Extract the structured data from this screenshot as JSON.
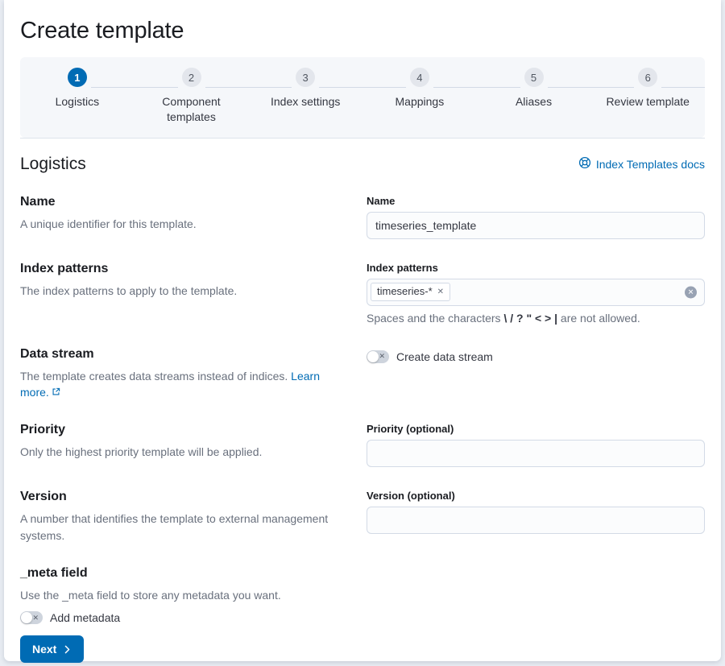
{
  "page": {
    "title": "Create template"
  },
  "stepper": {
    "steps": [
      {
        "number": "1",
        "label": "Logistics",
        "status": "active"
      },
      {
        "number": "2",
        "label": "Component templates",
        "status": "incomplete"
      },
      {
        "number": "3",
        "label": "Index settings",
        "status": "incomplete"
      },
      {
        "number": "4",
        "label": "Mappings",
        "status": "incomplete"
      },
      {
        "number": "5",
        "label": "Aliases",
        "status": "incomplete"
      },
      {
        "number": "6",
        "label": "Review template",
        "status": "incomplete"
      }
    ]
  },
  "section": {
    "title": "Logistics",
    "docs_link_label": "Index Templates docs"
  },
  "rows": {
    "name": {
      "title": "Name",
      "description": "A unique identifier for this template.",
      "field_label": "Name",
      "field_value": "timeseries_template"
    },
    "index_patterns": {
      "title": "Index patterns",
      "description": "The index patterns to apply to the template.",
      "field_label": "Index patterns",
      "chip_value": "timeseries-*",
      "chip_remove": "✕",
      "help_prefix": "Spaces and the characters ",
      "help_chars": "\\ / ? \" < > |",
      "help_suffix": " are not allowed."
    },
    "data_stream": {
      "title": "Data stream",
      "description": "The template creates data streams instead of indices. ",
      "link_label": "Learn more.",
      "toggle_label": "Create data stream",
      "toggle_state": "off"
    },
    "priority": {
      "title": "Priority",
      "description": "Only the highest priority template will be applied.",
      "field_label": "Priority (optional)",
      "field_value": ""
    },
    "version": {
      "title": "Version",
      "description": "A number that identifies the template to external management systems.",
      "field_label": "Version (optional)",
      "field_value": ""
    },
    "meta": {
      "title": "_meta field",
      "description": "Use the _meta field to store any metadata you want.",
      "toggle_label": "Add metadata",
      "toggle_state": "off"
    }
  },
  "footer": {
    "next_label": "Next"
  },
  "icons": {
    "docs": "life-buoy-icon",
    "external": "external-link-icon",
    "chevron": "chevron-right-icon",
    "clear": "clear-circle-icon"
  },
  "colors": {
    "primary": "#006bb4",
    "link": "#006bb4",
    "border": "#d3dae6",
    "panel_bg": "#f5f7fa",
    "page_bg": "#e9edf3",
    "text": "#343741",
    "subdued": "#69707d"
  }
}
